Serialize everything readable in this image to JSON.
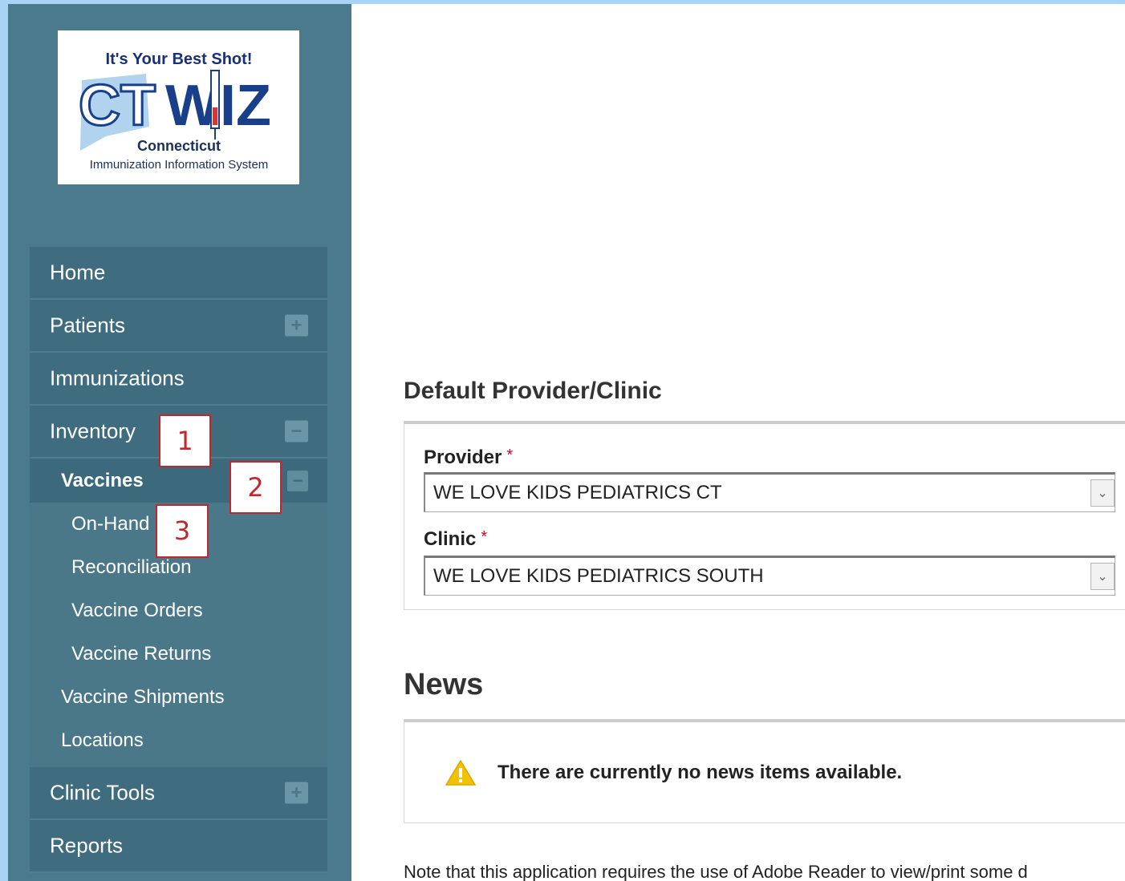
{
  "logo": {
    "tagline": "It's Your Best Shot!",
    "brand_ct": "CT",
    "brand_wiz": "WIZ",
    "state": "Connecticut",
    "subtitle": "Immunization Information System"
  },
  "sidebar": {
    "items": [
      {
        "label": "Home"
      },
      {
        "label": "Patients",
        "toggle": "+"
      },
      {
        "label": "Immunizations"
      },
      {
        "label": "Inventory",
        "toggle": "−"
      },
      {
        "label": "Clinic Tools",
        "toggle": "+"
      },
      {
        "label": "Reports"
      }
    ],
    "vaccines": {
      "label": "Vaccines",
      "toggle": "−"
    },
    "vaccine_items": [
      "On-Hand",
      "Reconciliation",
      "Vaccine Orders",
      "Vaccine Returns"
    ],
    "inventory_items": [
      "Vaccine Shipments",
      "Locations"
    ]
  },
  "callouts": [
    "1",
    "2",
    "3"
  ],
  "main": {
    "default_title": "Default Provider/Clinic",
    "provider_label": "Provider",
    "provider_value": "WE LOVE KIDS PEDIATRICS CT",
    "clinic_label": "Clinic",
    "clinic_value": "WE LOVE KIDS PEDIATRICS SOUTH",
    "required_mark": "*",
    "news_title": "News",
    "news_empty": "There are currently no news items available.",
    "note": "Note that this application requires the use of Adobe Reader to view/print some d"
  },
  "colors": {
    "sidebar_bg": "#4b7a8c",
    "menu_bg": "#3f6d7f",
    "callout": "#c0282f",
    "page_bg": "#a8d3f5",
    "warning": "#f2c200"
  },
  "icons": {
    "toggle_expand": "plus-icon",
    "toggle_collapse": "minus-icon",
    "select_arrow": "chevron-down-icon",
    "news_warning": "warning-icon"
  }
}
